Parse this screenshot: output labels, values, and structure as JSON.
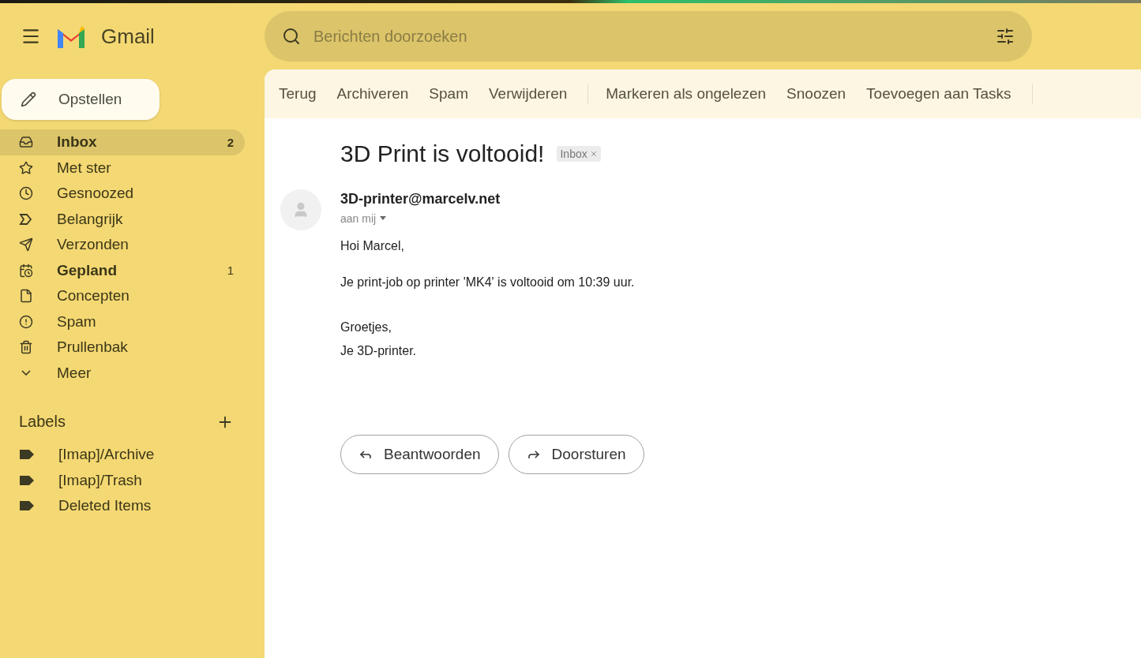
{
  "app": {
    "name": "Gmail"
  },
  "search": {
    "placeholder": "Berichten doorzoeken"
  },
  "compose": {
    "label": "Opstellen"
  },
  "nav": [
    {
      "label": "Inbox",
      "count": "2",
      "unread": true,
      "selected": true
    },
    {
      "label": "Met ster",
      "unread": false,
      "selected": false
    },
    {
      "label": "Gesnoozed",
      "unread": false,
      "selected": false
    },
    {
      "label": "Belangrijk",
      "unread": false,
      "selected": false
    },
    {
      "label": "Verzonden",
      "unread": false,
      "selected": false
    },
    {
      "label": "Gepland",
      "count": "1",
      "unread": true,
      "selected": false
    },
    {
      "label": "Concepten",
      "unread": false,
      "selected": false
    },
    {
      "label": "Spam",
      "unread": false,
      "selected": false
    },
    {
      "label": "Prullenbak",
      "unread": false,
      "selected": false
    },
    {
      "label": "Meer",
      "unread": false,
      "selected": false
    }
  ],
  "labels": {
    "title": "Labels",
    "items": [
      "[Imap]/Archive",
      "[Imap]/Trash",
      "Deleted Items"
    ]
  },
  "toolbar": [
    [
      "Terug",
      "Archiveren",
      "Spam",
      "Verwijderen"
    ],
    [
      "Markeren als ongelezen",
      "Snoozen",
      "Toevoegen aan Tasks"
    ]
  ],
  "message": {
    "subject": "3D Print is voltooid!",
    "tag": "Inbox",
    "sender": "3D-printer@marcelv.net",
    "recipient": "aan mij",
    "body": [
      [
        "Hoi Marcel,"
      ],
      [
        "Je print-job op printer 'MK4' is voltooid om 10:39 uur."
      ],
      [
        "Groetjes,",
        "Je 3D-printer."
      ]
    ],
    "actions": [
      "Beantwoorden",
      "Doorsturen"
    ]
  }
}
